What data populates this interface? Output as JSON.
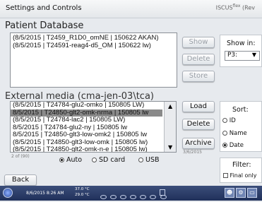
{
  "window": {
    "title": "Settings and Controls",
    "brand": "ISCUS",
    "brand_sup": "flex",
    "brand_suffix": "(Rev"
  },
  "patient_db": {
    "title": "Patient Database",
    "items": [
      "(8/5/2015 | T2459_R1D0_omNE | 150622 AKAN)",
      "(8/5/2015 | T24591-reag4-d5_OM | 150622 lw)"
    ],
    "buttons": {
      "show": "Show",
      "delete": "Delete",
      "store": "Store"
    },
    "show_in": {
      "label": "Show in:",
      "value": "P3:"
    }
  },
  "external": {
    "title": "External media (cma-jen-03\\tca)",
    "items": [
      "(8/5/2015 | T24784-glu2-omko | 150805 LW)",
      "8/5/2015 | T24850-glt2-omk-nrma | 150805 lw",
      "(8/5/2015 | T24784-lac2 | 150805 LW)",
      "8/5/2015 | T24784-glu2-ny | 150805 lw",
      "8/5/2015 | T24850-glt3-low-omk2 | 150805 lw",
      "(8/5/2015 | T24850-glt3-low-omk | 150805 lw)",
      "(8/5/2015 | T24850-glt2-omk-n-e | 150805 lw)"
    ],
    "selected_index": 1,
    "count": "2 of (90)",
    "buttons": {
      "load": "Load",
      "delete": "Delete",
      "archive": "Archive"
    },
    "archive_date": "3/6/2015",
    "source": {
      "auto": "Auto",
      "sd": "SD card",
      "usb": "USB",
      "selected": "auto"
    },
    "sort": {
      "label": "Sort:",
      "id": "ID",
      "name": "Name",
      "date": "Date",
      "selected": "date"
    },
    "filter": {
      "label": "Filter:",
      "final_only": "Final only",
      "final_only_checked": false
    }
  },
  "back_label": "Back",
  "taskbar": {
    "datetime": "8/6/2015 8:26 AM",
    "temp1": "37.0 °C",
    "temp2": "29.0 °C"
  },
  "colors": {
    "taskbar": "#2b3b66",
    "selection": "#8a8a8a"
  }
}
